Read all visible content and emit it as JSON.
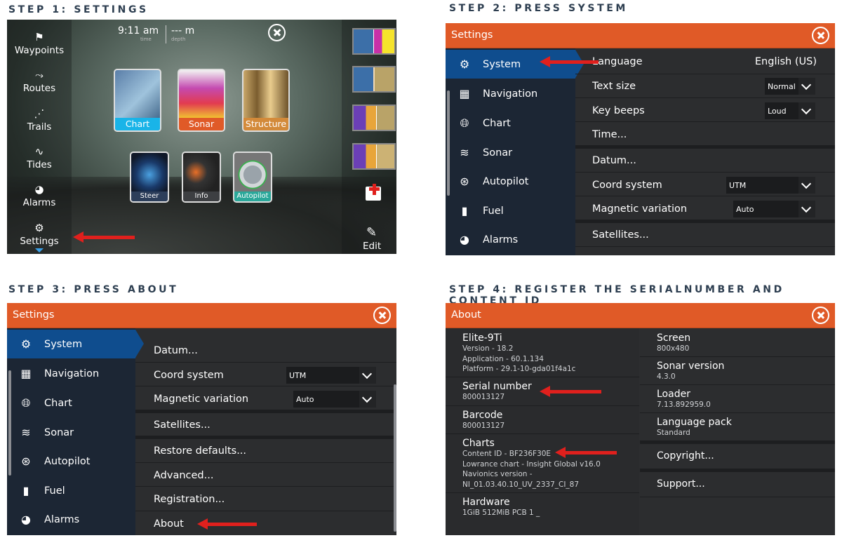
{
  "steps": {
    "s1": "STEP 1: SETTINGS",
    "s2": "STEP 2: PRESS SYSTEM",
    "s3": "STEP 3: PRESS ABOUT",
    "s4": "STEP 4: REGISTER THE SERIALNUMBER AND CONTENT ID"
  },
  "home": {
    "time": "9:11 am",
    "time_sub": "time",
    "depth": "--- m",
    "depth_sub": "depth",
    "left_nav": [
      "Waypoints",
      "Routes",
      "Trails",
      "Tides",
      "Alarms",
      "Settings"
    ],
    "apps_top": [
      "Chart",
      "Sonar",
      "Structure"
    ],
    "apps_bottom": [
      "Steer",
      "Info",
      "Autopilot"
    ],
    "edit": "Edit",
    "colors": {
      "chart_cap": "#19b4e8",
      "sonar_cap": "#e05a27",
      "structure_cap": "#d38a3a"
    }
  },
  "settings": {
    "title": "Settings",
    "nav": [
      "System",
      "Navigation",
      "Chart",
      "Sonar",
      "Autopilot",
      "Fuel",
      "Alarms"
    ],
    "rows2": {
      "language": "Language",
      "language_val": "English (US)",
      "text_size": "Text size",
      "text_size_val": "Normal",
      "key_beeps": "Key beeps",
      "key_beeps_val": "Loud",
      "time": "Time...",
      "datum": "Datum...",
      "coord": "Coord system",
      "coord_val": "UTM",
      "magvar": "Magnetic variation",
      "magvar_val": "Auto",
      "satellites": "Satellites..."
    },
    "rows3": {
      "datum": "Datum...",
      "coord": "Coord system",
      "coord_val": "UTM",
      "magvar": "Magnetic variation",
      "magvar_val": "Auto",
      "satellites": "Satellites...",
      "restore": "Restore defaults...",
      "advanced": "Advanced...",
      "registration": "Registration...",
      "about": "About"
    }
  },
  "about": {
    "title": "About",
    "left": {
      "model": "Elite-9Ti",
      "version": "Version - 18.2",
      "application": "Application - 60.1.134",
      "platform": "Platform - 29.1-10-gda01f4a1c",
      "serial_label": "Serial number",
      "serial_val": "800013127",
      "barcode_label": "Barcode",
      "barcode_val": "800013127",
      "charts_label": "Charts",
      "content_id": "Content ID - BF236F30E",
      "lowrance": "Lowrance chart - Insight Global v16.0",
      "navionics": "Navionics version -",
      "navionics_val": "NI_01.03.40.10_UV_2337_CI_87",
      "hardware_label": "Hardware",
      "hardware_val": "1GiB 512MiB PCB 1 _"
    },
    "right": {
      "screen_label": "Screen",
      "screen_val": "800x480",
      "sonar_label": "Sonar version",
      "sonar_val": "4.3.0",
      "loader_label": "Loader",
      "loader_val": "7.13.892959.0",
      "lang_label": "Language pack",
      "lang_val": "Standard",
      "copyright": "Copyright...",
      "support": "Support..."
    }
  }
}
